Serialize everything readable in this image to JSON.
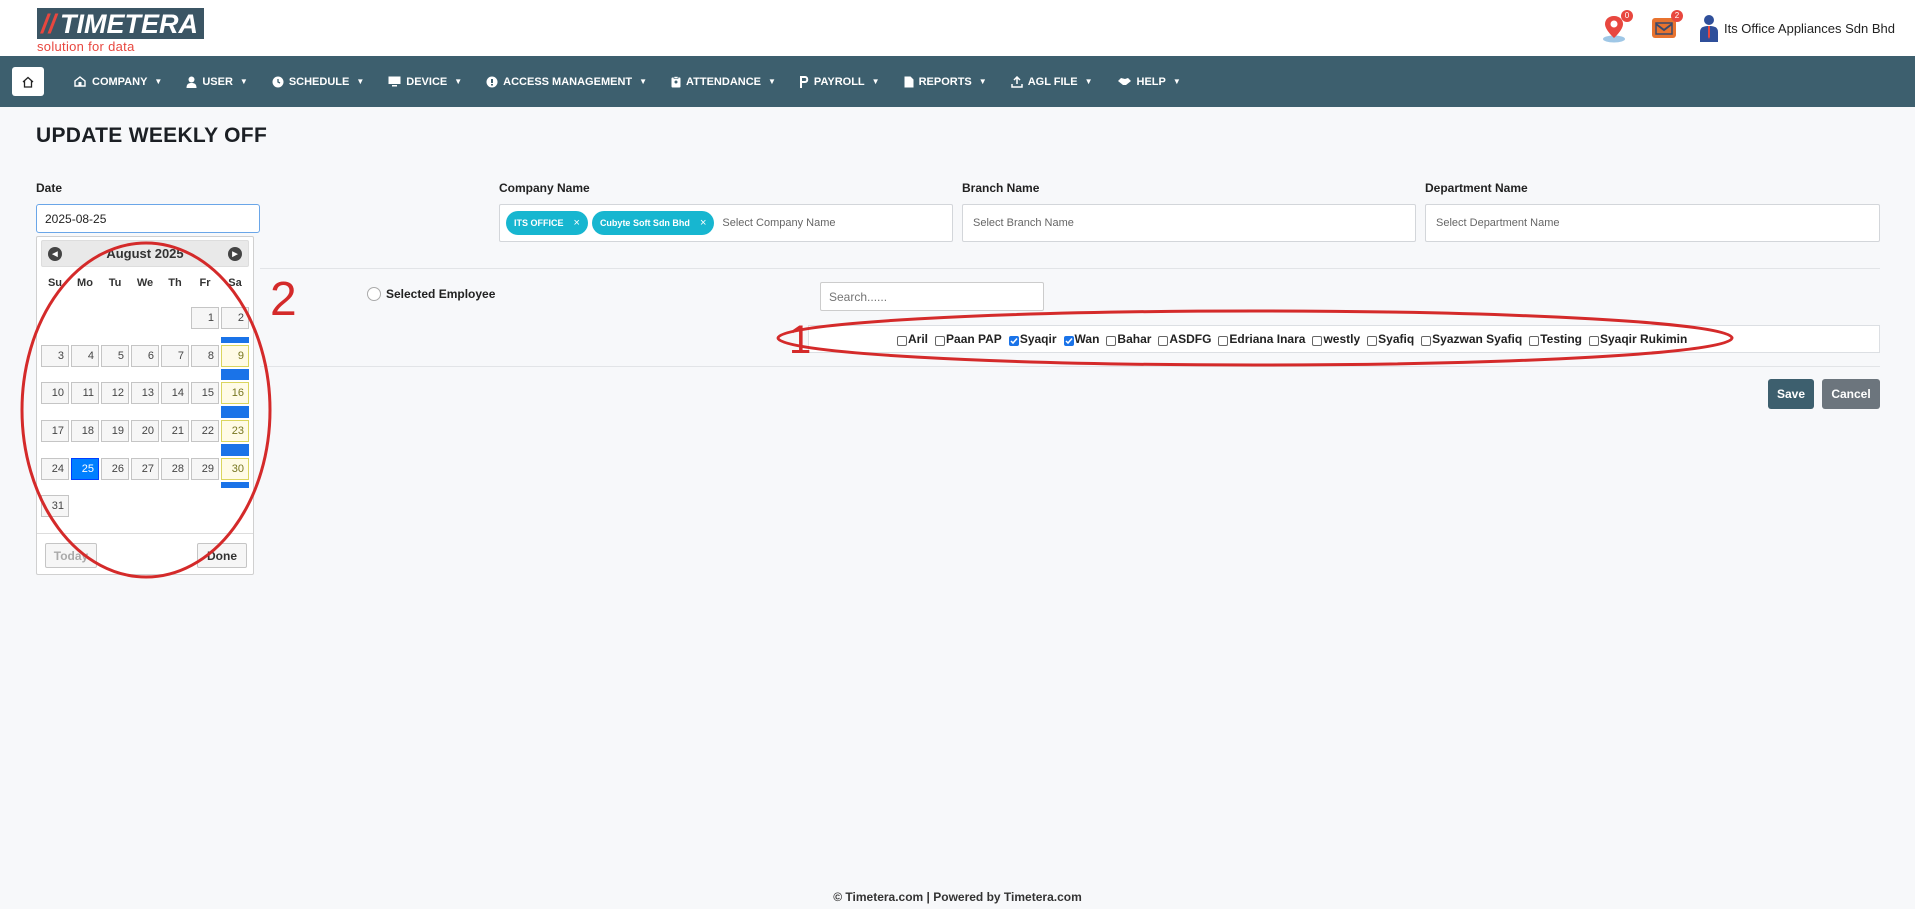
{
  "brand": {
    "name": "TIMETERA",
    "slashes": "//",
    "tagline": "solution for data"
  },
  "header": {
    "location_badge": "0",
    "mail_badge": "2",
    "user_name": "Its Office Appliances Sdn Bhd"
  },
  "nav": {
    "items": [
      {
        "label": "COMPANY",
        "icon": "company-icon"
      },
      {
        "label": "USER",
        "icon": "user-icon"
      },
      {
        "label": "SCHEDULE",
        "icon": "clock-icon"
      },
      {
        "label": "DEVICE",
        "icon": "monitor-icon"
      },
      {
        "label": "ACCESS MANAGEMENT",
        "icon": "access-icon"
      },
      {
        "label": "ATTENDANCE",
        "icon": "clipboard-icon"
      },
      {
        "label": "PAYROLL",
        "icon": "payroll-icon"
      },
      {
        "label": "REPORTS",
        "icon": "document-icon"
      },
      {
        "label": "AGL FILE",
        "icon": "upload-icon"
      },
      {
        "label": "HELP",
        "icon": "handshake-icon"
      }
    ]
  },
  "page": {
    "title": "UPDATE WEEKLY OFF"
  },
  "form": {
    "date_label": "Date",
    "date_value": "2025-08-25",
    "company_label": "Company Name",
    "company_chips": [
      "ITS OFFICE",
      "Cubyte Soft Sdn Bhd"
    ],
    "company_placeholder": "Select Company Name",
    "branch_label": "Branch Name",
    "branch_placeholder": "Select Branch Name",
    "department_label": "Department Name",
    "department_placeholder": "Select Department Name",
    "radio_label": "Selected Employee",
    "search_placeholder": "Search......",
    "employees": [
      {
        "name": "Aril",
        "checked": false
      },
      {
        "name": "Paan PAP",
        "checked": false
      },
      {
        "name": "Syaqir",
        "checked": true
      },
      {
        "name": "Wan",
        "checked": true
      },
      {
        "name": "Bahar",
        "checked": false
      },
      {
        "name": "ASDFG",
        "checked": false
      },
      {
        "name": "Edriana Inara",
        "checked": false
      },
      {
        "name": "westly",
        "checked": false
      },
      {
        "name": "Syafiq",
        "checked": false
      },
      {
        "name": "Syazwan Syafiq",
        "checked": false
      },
      {
        "name": "Testing",
        "checked": false
      },
      {
        "name": "Syaqir Rukimin",
        "checked": false
      }
    ],
    "save_label": "Save",
    "cancel_label": "Cancel"
  },
  "datepicker": {
    "month_title": "August 2025",
    "weekdays": [
      "Su",
      "Mo",
      "Tu",
      "We",
      "Th",
      "Fr",
      "Sa"
    ],
    "first_weekday_index": 5,
    "days_in_month": 31,
    "selected_day": 25,
    "highlighted_weekday_index": 6,
    "today_label": "Today",
    "done_label": "Done"
  },
  "annotations": {
    "mark_1": "1",
    "mark_2": "2",
    "color": "#d42a2a"
  },
  "footer": {
    "text": "© Timetera.com  |  Powered by Timetera.com"
  },
  "colors": {
    "nav_bg": "#3d5f6e",
    "chip": "#17b6d0",
    "brand_red": "#e8473f",
    "selected_day": "#007fff"
  }
}
